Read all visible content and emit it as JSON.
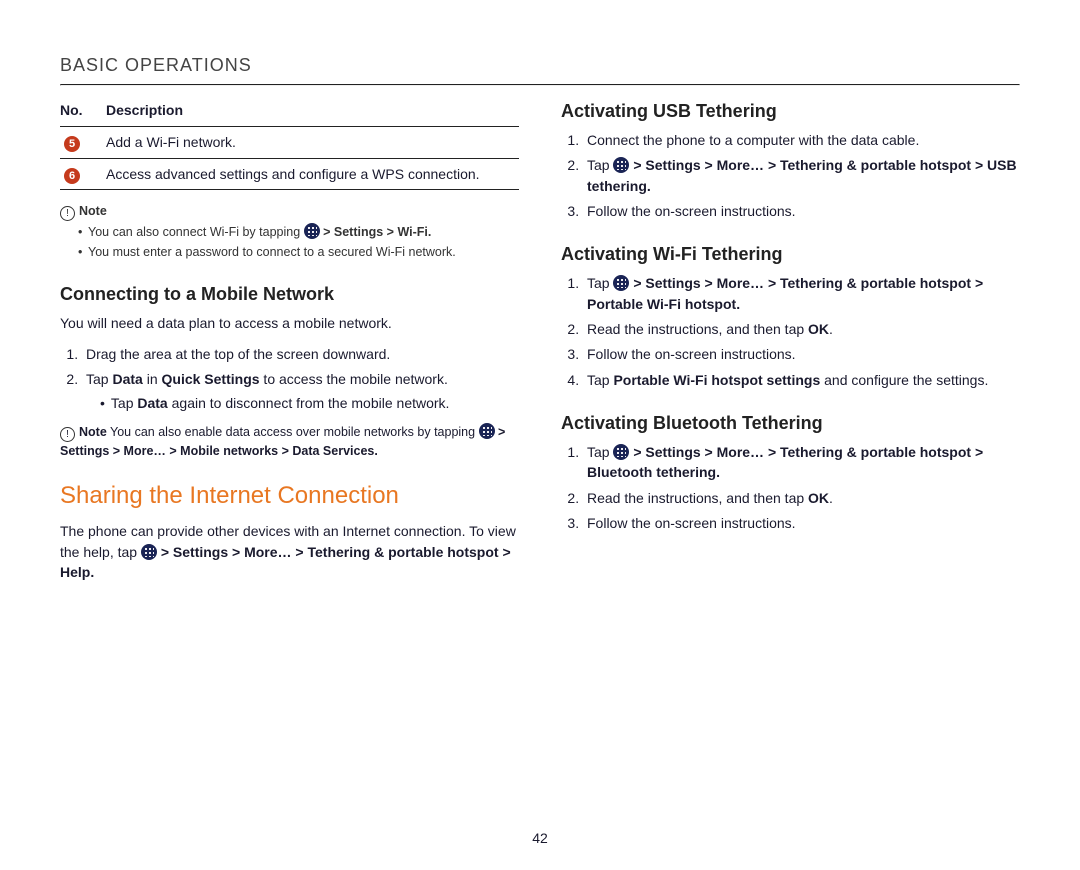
{
  "header": "BASIC OPERATIONS",
  "page_number": "42",
  "table": {
    "head_no": "No.",
    "head_desc": "Description",
    "rows": [
      {
        "num": "5",
        "desc": "Add a Wi-Fi network."
      },
      {
        "num": "6",
        "desc": "Access advanced settings and configure a WPS connection."
      }
    ]
  },
  "note1": {
    "label": "Note",
    "items": [
      {
        "pre": "You can also connect Wi-Fi by tapping ",
        "path": " > Settings > Wi-Fi."
      },
      {
        "text": "You must enter a password to connect to a secured Wi-Fi network."
      }
    ]
  },
  "mobile": {
    "heading": "Connecting to a Mobile Network",
    "intro": "You will need a data plan to access a mobile network.",
    "steps": [
      "Drag the area at the top of the screen downward.",
      {
        "pre": "Tap ",
        "b1": "Data",
        "mid": " in ",
        "b2": "Quick Settings",
        "post": " to access the mobile network."
      }
    ],
    "sub": {
      "pre": "Tap ",
      "b": "Data",
      "post": " again to disconnect from the mobile network."
    },
    "note": {
      "label": "Note",
      "pre": " You can also enable data access over mobile networks by tapping ",
      "path": " > Settings > More… > Mobile networks > Data Services."
    }
  },
  "sharing": {
    "heading": "Sharing the Internet Connection",
    "intro_pre": "The phone can provide other devices with an Internet connection. To view the help, tap ",
    "intro_path": " > Settings > More… > Tethering & portable hotspot > Help."
  },
  "usb": {
    "heading": "Activating USB Tethering",
    "steps": [
      "Connect the phone to a computer with the data cable.",
      {
        "pre": "Tap ",
        "path": " > Settings > More… > Tethering & portable hotspot > USB tethering."
      },
      "Follow the on-screen instructions."
    ]
  },
  "wifi": {
    "heading": "Activating Wi-Fi Tethering",
    "steps": [
      {
        "pre": "Tap ",
        "path": " > Settings > More… > Tethering & portable hotspot > Portable Wi-Fi hotspot."
      },
      {
        "pre": "Read the instructions, and then tap ",
        "b": "OK",
        "post": "."
      },
      "Follow the on-screen instructions.",
      {
        "pre": "Tap ",
        "b": "Portable Wi-Fi hotspot settings",
        "post": " and configure the settings."
      }
    ]
  },
  "bt": {
    "heading": "Activating Bluetooth Tethering",
    "steps": [
      {
        "pre": "Tap ",
        "path": " > Settings > More… > Tethering & portable hotspot > Bluetooth tethering."
      },
      {
        "pre": "Read the instructions, and then tap ",
        "b": "OK",
        "post": "."
      },
      "Follow the on-screen instructions."
    ]
  }
}
